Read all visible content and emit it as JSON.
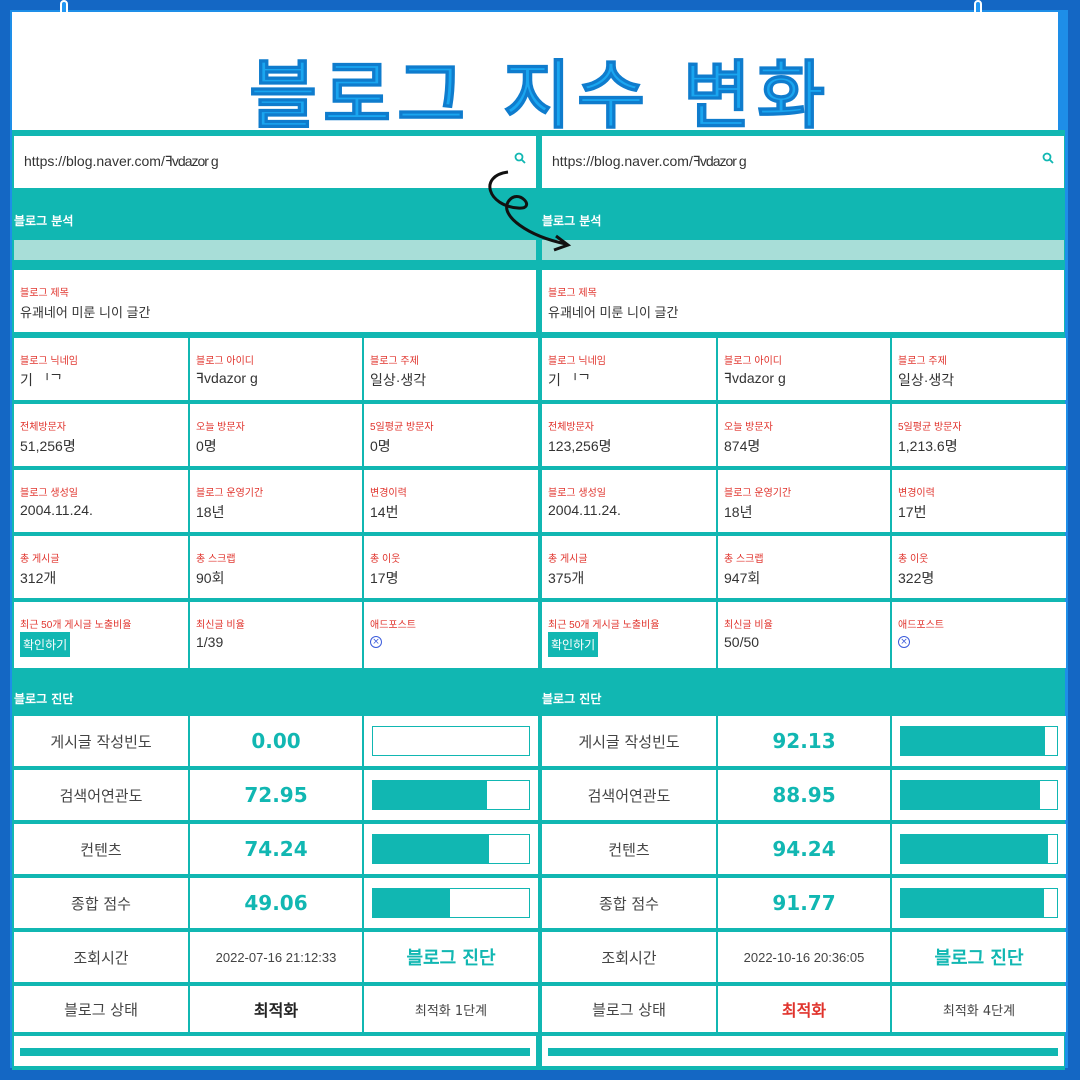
{
  "title": "블로그 지수 변화",
  "colors": {
    "accent": "#11b7b2",
    "frame": "#1467c4",
    "title": "#1aa6f0",
    "label": "#e0332c"
  },
  "icons": {
    "search": "search-icon",
    "arrow": "curved-arrow-icon",
    "adpost": "circle-x-icon"
  },
  "sections": {
    "analysis": "블로그 분석",
    "diagnosis": "블로그 진단"
  },
  "labels": {
    "blog_title": "블로그 제목",
    "nickname": "블로그 닉네임",
    "blog_id": "블로그 아이디",
    "topic": "블로그 주제",
    "total_visitors": "전체방문자",
    "today_visitors": "오늘 방문자",
    "avg5_visitors": "5일평균 방문자",
    "created": "블로그 생성일",
    "period": "블로그 운영기간",
    "changes": "변경이력",
    "posts": "총 게시글",
    "scraps": "총 스크랩",
    "neighbors": "총 이웃",
    "exposure": "최근 50개 게시글 노출비율",
    "latest_ratio": "최신글 비율",
    "adpost": "애드포스트",
    "check_button": "확인하기",
    "freq": "게시글 작성빈도",
    "keyword": "검색어연관도",
    "content": "컨텐츠",
    "total": "종합 점수",
    "time": "조회시간",
    "diag_link": "블로그 진단",
    "state": "블로그 상태"
  },
  "left": {
    "url": "https://blog.naver.com/",
    "url_blur": "ꟻvdazor g",
    "blog_title_blur": "유괘네어 미룬 니이 글간",
    "nickname_blur": "기 ᅵᄀ",
    "blog_id_blur": "ꟻvdazor g",
    "topic": "일상·생각",
    "total_visitors": "51,256명",
    "today_visitors": "0명",
    "avg5_visitors": "0명",
    "created": "2004.11.24.",
    "period": "18년",
    "changes": "14번",
    "posts": "312개",
    "scraps": "90회",
    "neighbors": "17명",
    "latest_ratio": "1/39",
    "freq": "0.00",
    "freq_pct": 0,
    "keyword": "72.95",
    "keyword_pct": 72.95,
    "content": "74.24",
    "content_pct": 74.24,
    "total": "49.06",
    "total_pct": 49.06,
    "time": "2022-07-16 21:12:33",
    "state": "최적화",
    "stage": "최적화 1단계"
  },
  "right": {
    "url": "https://blog.naver.com/",
    "url_blur": "ꟻvdazor g",
    "blog_title_blur": "유괘네어 미룬 니이 글간",
    "nickname_blur": "기 ᅵᄀ",
    "blog_id_blur": "ꟻvdazor g",
    "topic": "일상·생각",
    "total_visitors": "123,256명",
    "today_visitors": "874명",
    "avg5_visitors": "1,213.6명",
    "created": "2004.11.24.",
    "period": "18년",
    "changes": "17번",
    "posts": "375개",
    "scraps": "947회",
    "neighbors": "322명",
    "latest_ratio": "50/50",
    "freq": "92.13",
    "freq_pct": 92.13,
    "keyword": "88.95",
    "keyword_pct": 88.95,
    "content": "94.24",
    "content_pct": 94.24,
    "total": "91.77",
    "total_pct": 91.77,
    "time": "2022-10-16 20:36:05",
    "state": "최적화",
    "stage": "최적화 4단계"
  }
}
